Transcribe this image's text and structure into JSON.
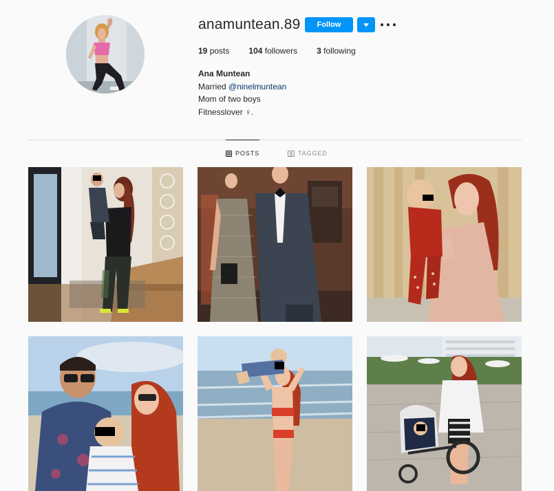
{
  "profile": {
    "username": "anamuntean.89",
    "follow_label": "Follow",
    "dropdown_icon": "chevron-down-icon",
    "more_icon": "ellipsis-icon",
    "stats": [
      {
        "count": "19",
        "label": "posts"
      },
      {
        "count": "104",
        "label": "followers"
      },
      {
        "count": "3",
        "label": "following"
      }
    ],
    "bio": {
      "name": "Ana Muntean",
      "line1_prefix": "Married ",
      "mention": "@ninelmuntean",
      "line2": "Mom of two boys",
      "line3": "Fitnesslover ♀."
    }
  },
  "tabs": [
    {
      "label": "POSTS",
      "icon": "grid-icon",
      "active": true
    },
    {
      "label": "TAGGED",
      "icon": "tagged-user-icon",
      "active": false
    }
  ],
  "colors": {
    "accent": "#0095f6",
    "text": "#262626",
    "muted": "#8e8e8e",
    "background": "#fafafa",
    "divider": "#dbdbdb",
    "mention": "#00376b"
  },
  "posts": [
    {
      "kind": "photo",
      "subject": "woman-in-gym-clothes-holding-child-in-hallway"
    },
    {
      "kind": "photo",
      "subject": "couple-in-formal-dress-and-suit"
    },
    {
      "kind": "photo",
      "subject": "woman-holding-baby-in-red-outfit"
    },
    {
      "kind": "photo",
      "subject": "man-and-woman-with-baby-beach-selfie"
    },
    {
      "kind": "photo",
      "subject": "woman-lifting-baby-on-beach"
    },
    {
      "kind": "photo",
      "subject": "woman-with-stroller-in-park"
    }
  ]
}
